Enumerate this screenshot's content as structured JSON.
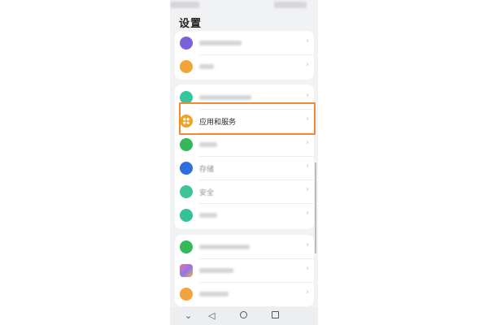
{
  "page": {
    "title": "设置"
  },
  "groups": [
    {
      "items": [
        {
          "label": "",
          "icon": "account-avatar-icon",
          "color": "#7b61d9"
        },
        {
          "label": "",
          "icon": "orange-app-icon",
          "color": "#f2a33a"
        }
      ]
    },
    {
      "items": [
        {
          "label": "",
          "icon": "teal-app-icon",
          "color": "#36c79e"
        },
        {
          "label": "应用和服务",
          "icon": "apps-grid-icon",
          "color": "#f0a424",
          "highlighted": true
        },
        {
          "label": "",
          "icon": "green-app-icon",
          "color": "#33b85a"
        },
        {
          "label": "存储",
          "icon": "storage-icon",
          "color": "#2f6fe0"
        },
        {
          "label": "安全",
          "icon": "security-icon",
          "color": "#3fc49a"
        },
        {
          "label": "",
          "icon": "teal-circle-icon",
          "color": "#35c197"
        }
      ]
    },
    {
      "items": [
        {
          "label": "",
          "icon": "green-app-icon-2",
          "color": "#33b85a"
        },
        {
          "label": "",
          "icon": "multicolor-app-icon",
          "color": "#e86fa1"
        },
        {
          "label": "",
          "icon": "orange-app-icon-2",
          "color": "#f2a33a"
        }
      ]
    }
  ],
  "navbar": {
    "back_glyph": "◁",
    "down_glyph": "⌄"
  },
  "chevron_glyph": "›",
  "highlight_color": "#ee8b3a"
}
